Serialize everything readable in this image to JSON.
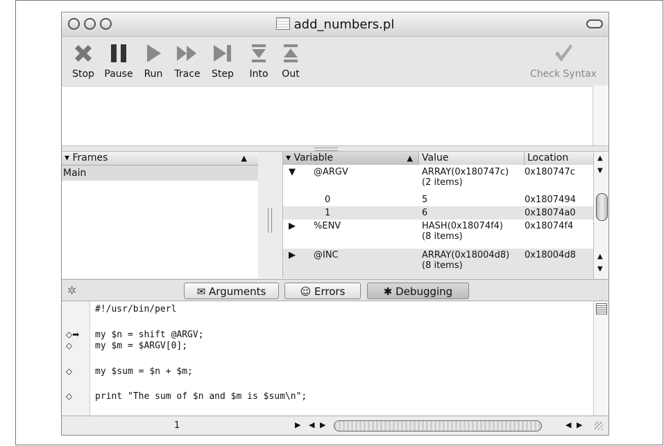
{
  "window": {
    "title": "add_numbers.pl"
  },
  "toolbar": {
    "buttons": [
      {
        "label": "Stop",
        "icon": "stop-x-icon"
      },
      {
        "label": "Pause",
        "icon": "pause-icon"
      },
      {
        "label": "Run",
        "icon": "play-icon"
      },
      {
        "label": "Trace",
        "icon": "fast-forward-icon"
      },
      {
        "label": "Step",
        "icon": "step-icon"
      },
      {
        "label": "Into",
        "icon": "step-into-icon"
      },
      {
        "label": "Out",
        "icon": "step-out-icon"
      },
      {
        "label": "Check Syntax",
        "icon": "checkmark-icon"
      }
    ]
  },
  "frames": {
    "header": "Frames",
    "rows": [
      "Main"
    ]
  },
  "variables": {
    "columns": [
      "Variable",
      "Value",
      "Location"
    ],
    "rows": [
      {
        "name": "@ARGV",
        "value": "ARRAY(0x180747c)",
        "detail": "(2 items)",
        "location": "0x180747c",
        "disclosure": "expanded"
      },
      {
        "name": "0",
        "value": "5",
        "detail": "",
        "location": "0x1807494",
        "disclosure": "none"
      },
      {
        "name": "1",
        "value": "6",
        "detail": "",
        "location": "0x18074a0",
        "disclosure": "none"
      },
      {
        "name": "%ENV",
        "value": "HASH(0x18074f4)",
        "detail": "(8 items)",
        "location": "0x18074f4",
        "disclosure": "collapsed"
      },
      {
        "name": "@INC",
        "value": "ARRAY(0x18004d8)",
        "detail": "(8 items)",
        "location": "0x18004d8",
        "disclosure": "collapsed"
      }
    ]
  },
  "tabs": [
    {
      "label": "Arguments",
      "icon": "arguments-icon",
      "selected": false
    },
    {
      "label": "Errors",
      "icon": "smiley-icon",
      "selected": false
    },
    {
      "label": "Debugging",
      "icon": "bug-icon",
      "selected": true
    }
  ],
  "code": {
    "lines": [
      {
        "text": "#!/usr/bin/perl",
        "marker": ""
      },
      {
        "text": "my $n = shift @ARGV;",
        "marker": "◇➡"
      },
      {
        "text": "my $m = $ARGV[0];",
        "marker": "◇"
      },
      {
        "text": "my $sum = $n + $m;",
        "marker": "◇"
      },
      {
        "text": "print \"The sum of $n and $m is $sum\\n\";",
        "marker": "◇"
      }
    ]
  },
  "status": {
    "line_number": "1"
  }
}
